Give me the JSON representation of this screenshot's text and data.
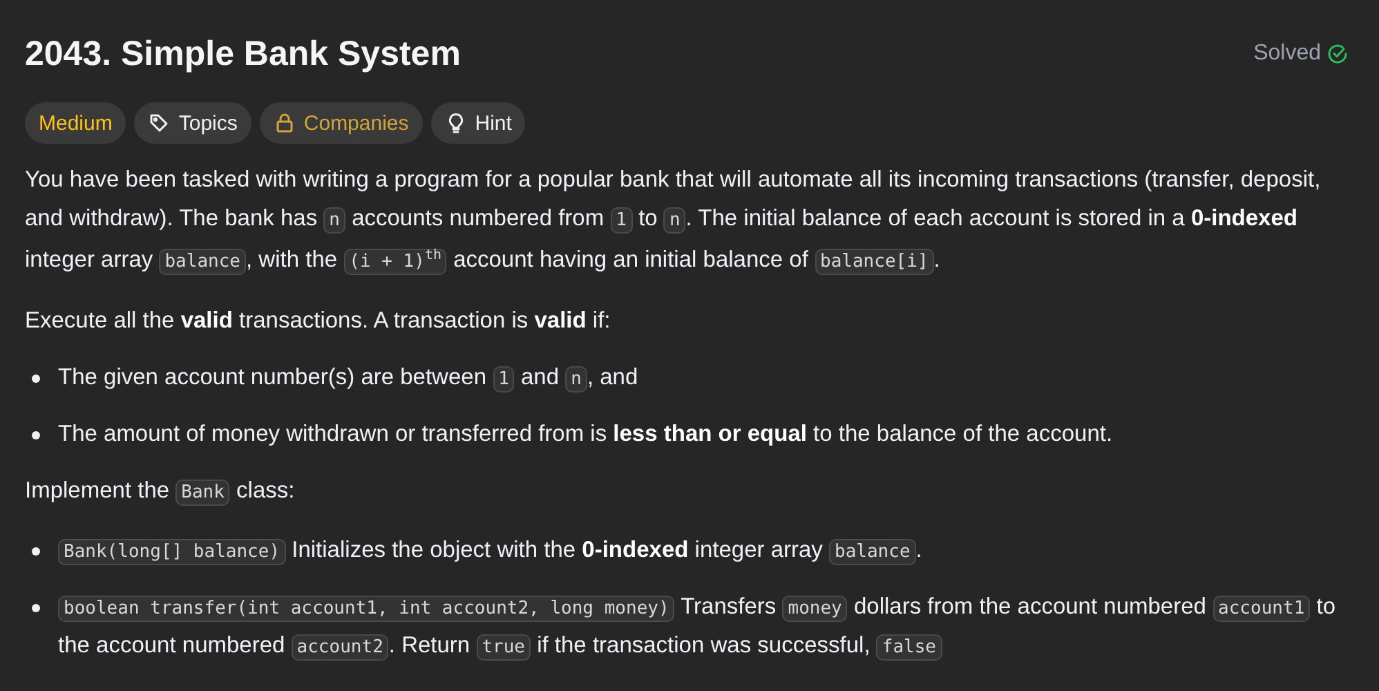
{
  "title": "2043. Simple Bank System",
  "status": {
    "label": "Solved",
    "solved": true
  },
  "tags": [
    {
      "kind": "difficulty",
      "label": "Medium"
    },
    {
      "kind": "topics",
      "label": "Topics"
    },
    {
      "kind": "companies",
      "label": "Companies"
    },
    {
      "kind": "hint",
      "label": "Hint"
    }
  ],
  "content": [
    {
      "kind": "paragraph",
      "segments": [
        {
          "kind": "text",
          "text": "You have been tasked with writing a program for a popular bank that will automate all its incoming transactions (transfer, deposit, and withdraw). The bank has "
        },
        {
          "kind": "code",
          "text": "n"
        },
        {
          "kind": "text",
          "text": " accounts numbered from "
        },
        {
          "kind": "code",
          "text": "1"
        },
        {
          "kind": "text",
          "text": " to "
        },
        {
          "kind": "code",
          "text": "n"
        },
        {
          "kind": "text",
          "text": ". The initial balance of each account is stored in a "
        },
        {
          "kind": "bold",
          "text": "0-indexed"
        },
        {
          "kind": "text",
          "text": " integer array "
        },
        {
          "kind": "code",
          "text": "balance"
        },
        {
          "kind": "text",
          "text": ", with the "
        },
        {
          "kind": "code",
          "text": "(i + 1)$^{th}$"
        },
        {
          "kind": "text",
          "text": " account having an initial balance of "
        },
        {
          "kind": "code",
          "text": "balance[i]"
        },
        {
          "kind": "text",
          "text": "."
        }
      ]
    },
    {
      "kind": "paragraph",
      "segments": [
        {
          "kind": "text",
          "text": "Execute all the "
        },
        {
          "kind": "bold",
          "text": "valid"
        },
        {
          "kind": "text",
          "text": " transactions. A transaction is "
        },
        {
          "kind": "bold",
          "text": "valid"
        },
        {
          "kind": "text",
          "text": " if:"
        }
      ]
    },
    {
      "kind": "bullet",
      "segments": [
        {
          "kind": "text",
          "text": "The given account number(s) are between "
        },
        {
          "kind": "code",
          "text": "1"
        },
        {
          "kind": "text",
          "text": " and "
        },
        {
          "kind": "code",
          "text": "n"
        },
        {
          "kind": "text",
          "text": ", and"
        }
      ]
    },
    {
      "kind": "bullet",
      "segments": [
        {
          "kind": "text",
          "text": "The amount of money withdrawn or transferred from is "
        },
        {
          "kind": "bold",
          "text": "less than or equal"
        },
        {
          "kind": "text",
          "text": " to the balance of the account."
        }
      ]
    },
    {
      "kind": "paragraph",
      "segments": [
        {
          "kind": "text",
          "text": "Implement the "
        },
        {
          "kind": "code",
          "text": "Bank"
        },
        {
          "kind": "text",
          "text": " class:"
        }
      ]
    },
    {
      "kind": "bullet",
      "segments": [
        {
          "kind": "code",
          "text": "Bank(long[] balance)"
        },
        {
          "kind": "text",
          "text": " Initializes the object with the "
        },
        {
          "kind": "bold",
          "text": "0-indexed"
        },
        {
          "kind": "text",
          "text": " integer array "
        },
        {
          "kind": "code",
          "text": "balance"
        },
        {
          "kind": "text",
          "text": "."
        }
      ]
    },
    {
      "kind": "bullet",
      "segments": [
        {
          "kind": "code",
          "text": "boolean transfer(int account1, int account2, long money)"
        },
        {
          "kind": "text",
          "text": " Transfers "
        },
        {
          "kind": "code",
          "text": "money"
        },
        {
          "kind": "text",
          "text": " dollars from the account numbered "
        },
        {
          "kind": "code",
          "text": "account1"
        },
        {
          "kind": "text",
          "text": " to the account numbered "
        },
        {
          "kind": "code",
          "text": "account2"
        },
        {
          "kind": "text",
          "text": ". Return "
        },
        {
          "kind": "code",
          "text": "true"
        },
        {
          "kind": "text",
          "text": " if the transaction was successful, "
        },
        {
          "kind": "code",
          "text": "false"
        }
      ]
    }
  ]
}
